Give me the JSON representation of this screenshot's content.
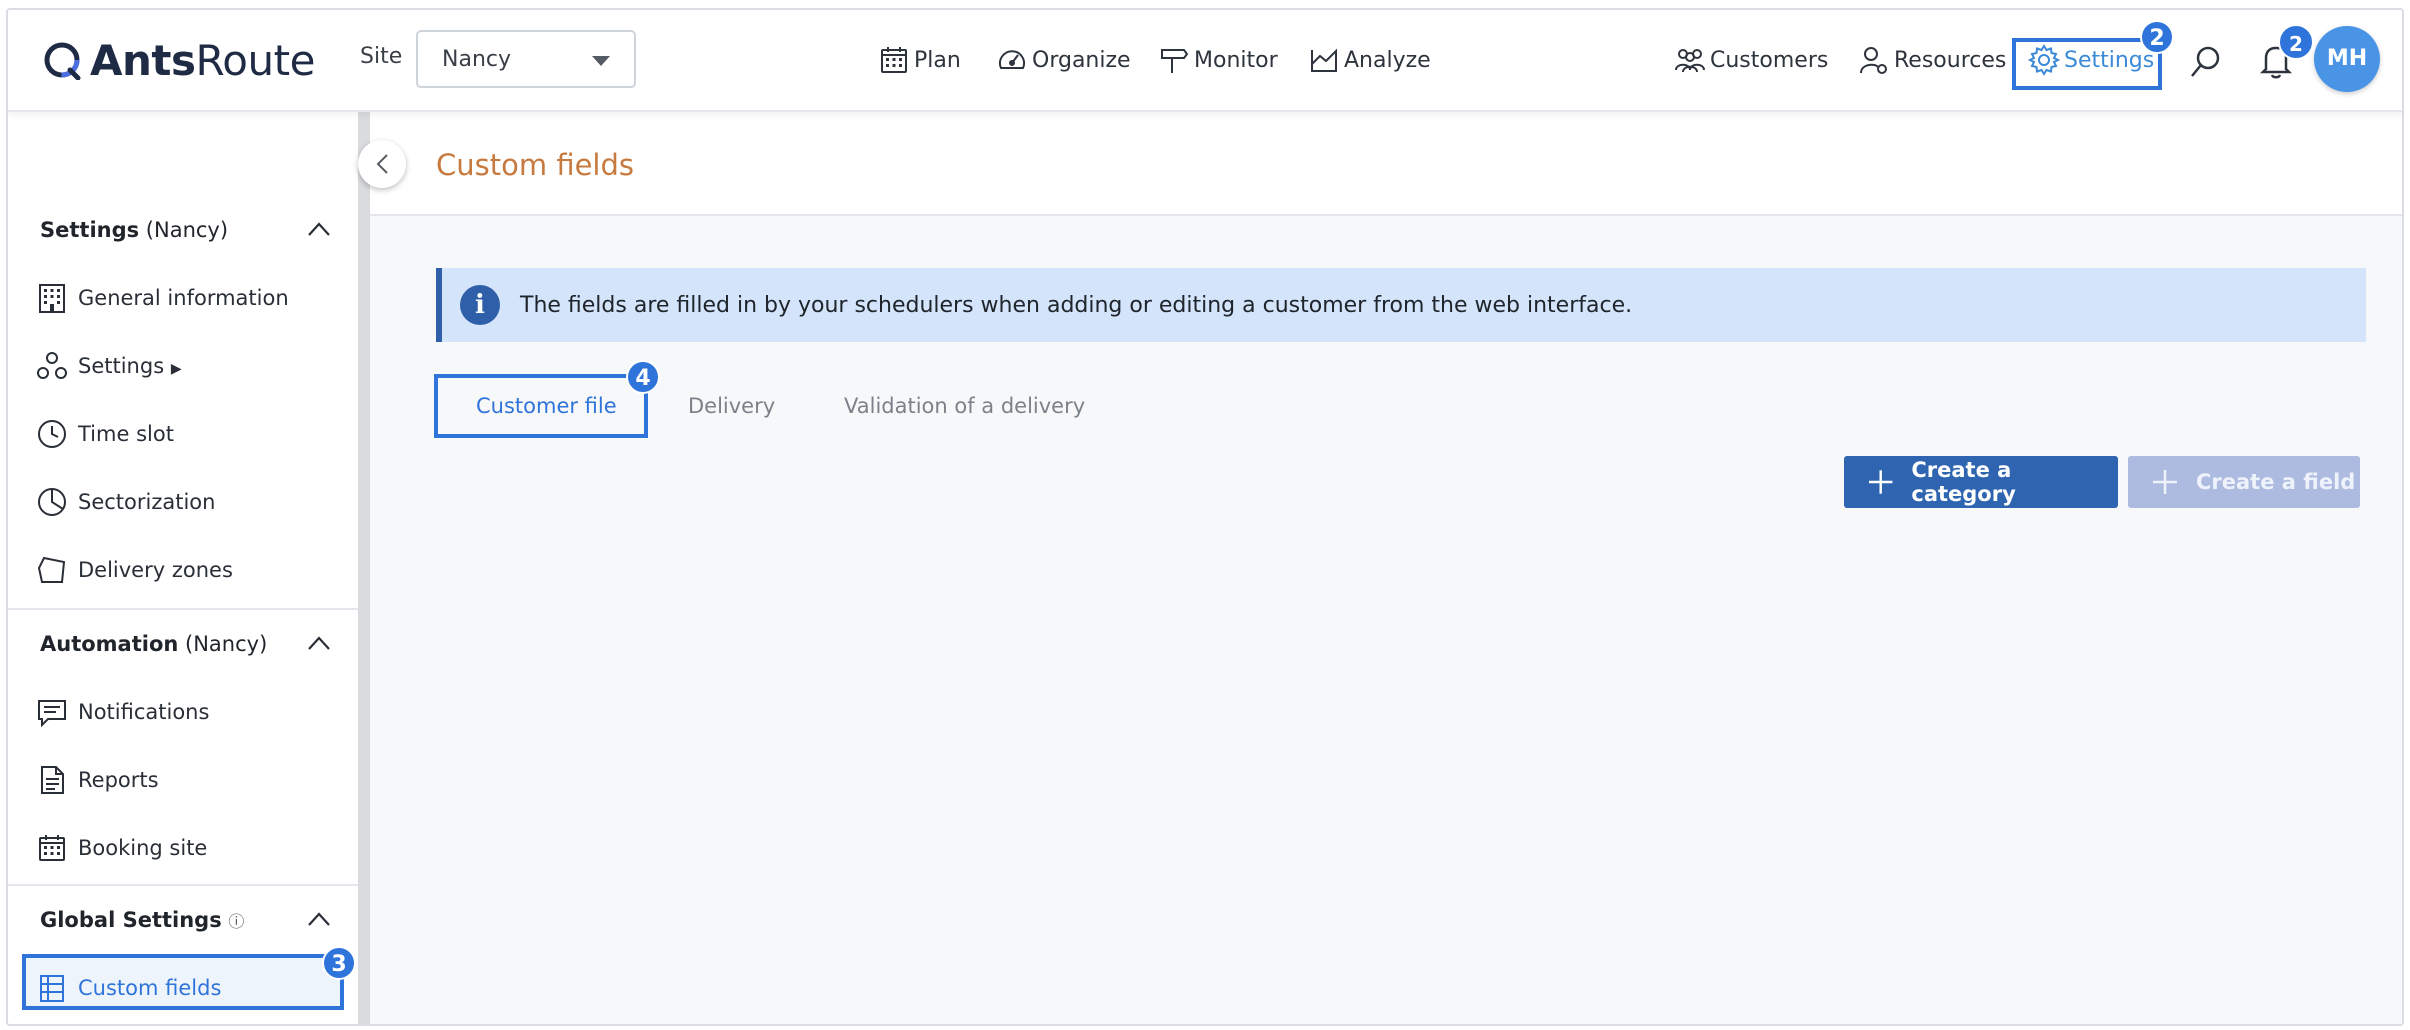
{
  "header": {
    "logo_bold": "Ants",
    "logo_light": "Route",
    "site_label": "Site",
    "site_value": "Nancy",
    "nav": {
      "plan": "Plan",
      "organize": "Organize",
      "monitor": "Monitor",
      "analyze": "Analyze",
      "customers": "Customers",
      "resources": "Resources",
      "settings": "Settings"
    },
    "notifications_count": "2",
    "avatar_initials": "MH"
  },
  "markers": {
    "settings": "2",
    "custom_fields": "3",
    "customer_file_tab": "4"
  },
  "sidebar": {
    "settings_section": {
      "title": "Settings",
      "suffix": " (Nancy)"
    },
    "settings_items": {
      "general": "General information",
      "settings": "Settings",
      "settings_arrow": "▶",
      "time_slot": "Time slot",
      "sectorization": "Sectorization",
      "delivery_zones": "Delivery zones"
    },
    "automation_section": {
      "title": "Automation",
      "suffix": " (Nancy)"
    },
    "automation_items": {
      "notifications": "Notifications",
      "reports": "Reports",
      "booking_site": "Booking site"
    },
    "global_section": {
      "title": "Global Settings",
      "info_glyph": "ⓘ"
    },
    "global_items": {
      "custom_fields": "Custom fields"
    }
  },
  "main": {
    "page_title": "Custom fields",
    "info_text": "The fields are filled in by your schedulers when adding or editing a customer from the web interface.",
    "tabs": {
      "customer_file": "Customer file",
      "delivery": "Delivery",
      "validation": "Validation of a delivery"
    },
    "buttons": {
      "create_category": "Create a category",
      "create_field": "Create a field"
    }
  },
  "colors": {
    "accent": "#2f74db",
    "title_orange": "#c77a3f",
    "primary_button": "#2f65b0",
    "disabled_button": "#aebbe0",
    "info_bg": "#d3e4fb"
  }
}
